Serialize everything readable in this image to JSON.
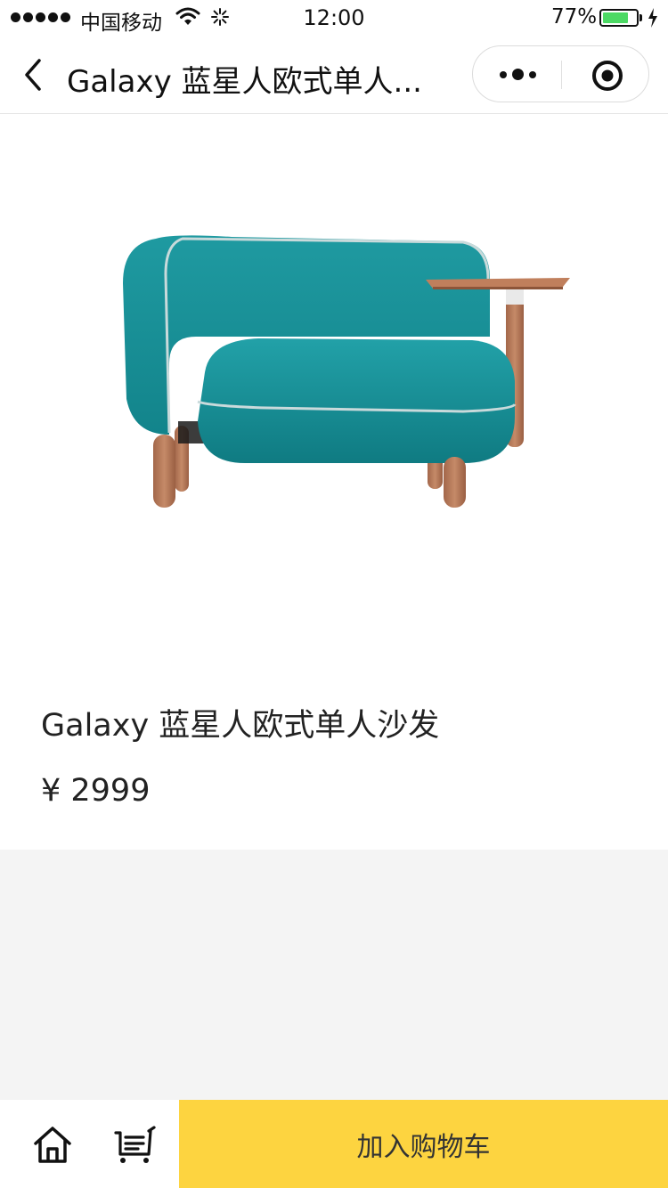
{
  "status_bar": {
    "carrier": "中国移动",
    "time": "12:00",
    "battery_percent": "77%",
    "battery_level": 0.77,
    "battery_color": "#4cd964"
  },
  "nav": {
    "title": "Galaxy 蓝星人欧式单人...",
    "back_icon": "chevron-left-icon",
    "more_icon": "more-dots-icon",
    "close_icon": "target-close-icon"
  },
  "product": {
    "image_description_icon": "sofa-image",
    "title": "Galaxy 蓝星人欧式单人沙发",
    "price": "¥ 2999"
  },
  "bottom_bar": {
    "home_icon": "home-icon",
    "cart_icon": "cart-icon",
    "add_to_cart_label": "加入购物车",
    "accent_color": "#fdd440"
  }
}
